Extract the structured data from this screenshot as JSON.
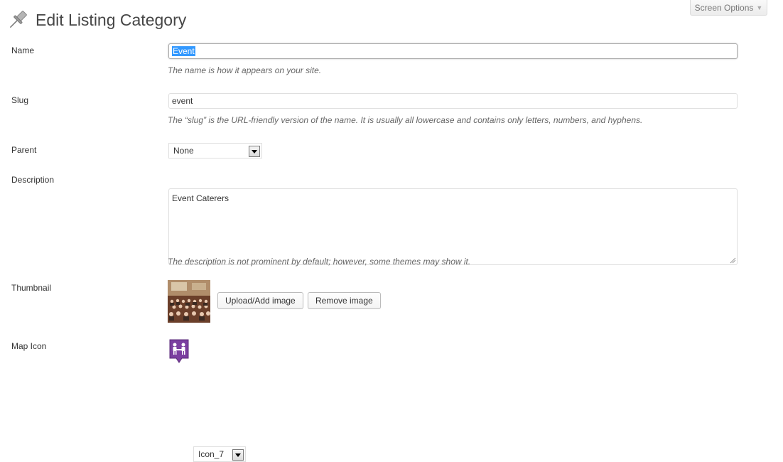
{
  "page": {
    "title": "Edit Listing Category"
  },
  "screen_options": {
    "label": "Screen Options",
    "arrow": "▼"
  },
  "form": {
    "name": {
      "label": "Name",
      "value": "Event",
      "description": "The name is how it appears on your site."
    },
    "slug": {
      "label": "Slug",
      "value": "event",
      "description": "The “slug” is the URL-friendly version of the name. It is usually all lowercase and contains only letters, numbers, and hyphens."
    },
    "parent": {
      "label": "Parent",
      "value": "None"
    },
    "description": {
      "label": "Description",
      "value": "Event Caterers",
      "description": "The description is not prominent by default; however, some themes may show it."
    },
    "thumbnail": {
      "label": "Thumbnail",
      "upload_label": "Upload/Add image",
      "remove_label": "Remove image"
    },
    "map_icon": {
      "label": "Map Icon",
      "value": "Icon_7",
      "icon_color": "#7b3fa0"
    }
  },
  "icons": {
    "header": "pushpin-icon",
    "thumbnail": "conference-photo",
    "map": "people-group-map-marker-icon"
  }
}
